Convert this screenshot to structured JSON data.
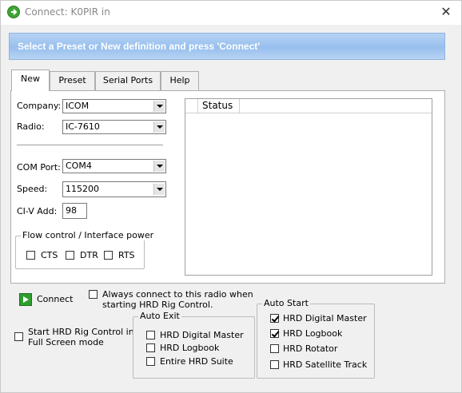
{
  "window": {
    "title": "Connect: K0PIR in",
    "close_glyph": "✕",
    "icon": "hrd-green-icon"
  },
  "banner": {
    "text": "Select a Preset or New definition and press 'Connect'"
  },
  "tabs": [
    {
      "label": "New",
      "active": true
    },
    {
      "label": "Preset",
      "active": false
    },
    {
      "label": "Serial Ports",
      "active": false
    },
    {
      "label": "Help",
      "active": false
    }
  ],
  "form": {
    "company": {
      "label": "Company:",
      "value": "ICOM"
    },
    "radio": {
      "label": "Radio:",
      "value": "IC-7610"
    },
    "com_port": {
      "label": "COM Port:",
      "value": "COM4"
    },
    "speed": {
      "label": "Speed:",
      "value": "115200"
    },
    "civ_address": {
      "label": "CI-V Add:",
      "value": "98"
    }
  },
  "flow_control": {
    "title": "Flow control / Interface power",
    "cts": {
      "label": "CTS",
      "checked": false
    },
    "dtr": {
      "label": "DTR",
      "checked": false
    },
    "rts": {
      "label": "RTS",
      "checked": false
    }
  },
  "status": {
    "column_header": "Status"
  },
  "connect_button": {
    "label": "Connect"
  },
  "always_connect": {
    "label_line1": "Always connect to this radio when",
    "label_line2": "starting HRD Rig Control.",
    "checked": false
  },
  "full_screen": {
    "label_line1": "Start HRD Rig Control in",
    "label_line2": "Full Screen mode",
    "checked": false
  },
  "auto_exit": {
    "title": "Auto Exit",
    "items": [
      {
        "label": "HRD Digital Master",
        "checked": false
      },
      {
        "label": "HRD Logbook",
        "checked": false
      },
      {
        "label": "Entire HRD Suite",
        "checked": false
      }
    ]
  },
  "auto_start": {
    "title": "Auto Start",
    "items": [
      {
        "label": "HRD Digital Master",
        "checked": true
      },
      {
        "label": "HRD Logbook",
        "checked": true
      },
      {
        "label": "HRD Rotator",
        "checked": false
      },
      {
        "label": "HRD Satellite Track",
        "checked": false
      }
    ]
  },
  "colors": {
    "banner": "#97bfee",
    "connect_icon": "#2f9e2f",
    "window_bg": "#f0f0f0"
  }
}
